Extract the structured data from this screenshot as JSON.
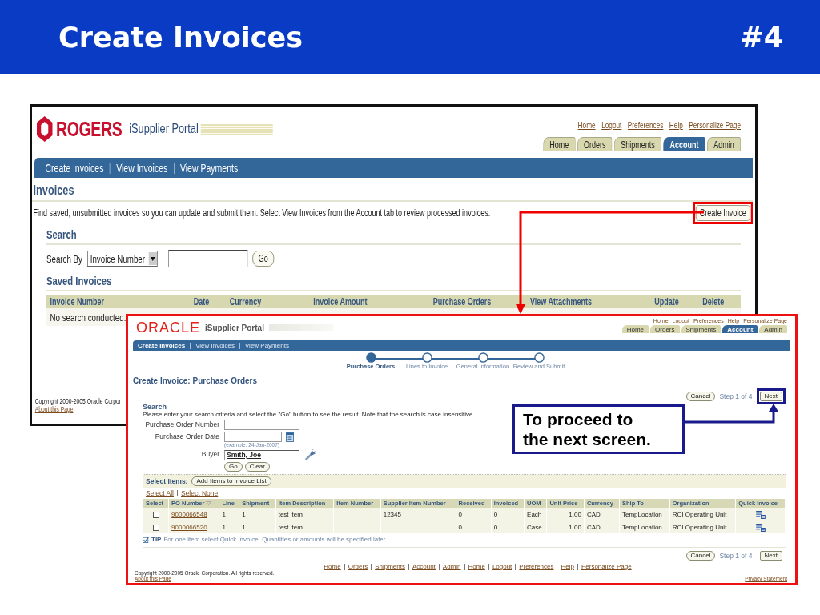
{
  "slide": {
    "title": "Create Invoices",
    "number": "#4"
  },
  "screen_1": {
    "logo_text": "ROGERS",
    "portal_name": "iSupplier Portal",
    "global_links": [
      "Home",
      "Logout",
      "Preferences",
      "Help",
      "Personalize Page"
    ],
    "tabs": [
      {
        "label": "Home",
        "selected": false
      },
      {
        "label": "Orders",
        "selected": false
      },
      {
        "label": "Shipments",
        "selected": false
      },
      {
        "label": "Account",
        "selected": true
      },
      {
        "label": "Admin",
        "selected": false
      }
    ],
    "subtabs": [
      "Create Invoices",
      "View Invoices",
      "View Payments"
    ],
    "page_title": "Invoices",
    "description": "Find saved, unsubmitted invoices so you can update and submit them. Select View Invoices from the Account tab to review processed invoices.",
    "create_button": {
      "label": "Create Invoice",
      "highlighted": true
    },
    "search": {
      "title": "Search",
      "label": "Search By",
      "select_value": "Invoice Number",
      "go_button": "Go"
    },
    "saved": {
      "title": "Saved Invoices",
      "columns": [
        "Invoice Number",
        "Date",
        "Currency",
        "Invoice Amount",
        "Purchase Orders",
        "View Attachments",
        "Update",
        "Delete"
      ],
      "empty_text": "No search conducted."
    },
    "copyright": "Copyright 2000-2005 Oracle Corpor",
    "about_link": "About this Page"
  },
  "screen_2": {
    "logo_text": "ORACLE",
    "portal_name": "iSupplier Portal",
    "global_links": [
      "Home",
      "Logout",
      "Preferences",
      "Help",
      "Personalize Page"
    ],
    "tabs": [
      {
        "label": "Home",
        "selected": false
      },
      {
        "label": "Orders",
        "selected": false
      },
      {
        "label": "Shipments",
        "selected": false
      },
      {
        "label": "Account",
        "selected": true
      },
      {
        "label": "Admin",
        "selected": false
      }
    ],
    "subtabs": [
      {
        "label": "Create Invoices",
        "selected": true
      },
      {
        "label": "View Invoices",
        "selected": false
      },
      {
        "label": "View Payments",
        "selected": false
      }
    ],
    "train": [
      {
        "label": "Purchase Orders",
        "selected": true
      },
      {
        "label": "Lines to Invoice",
        "selected": false
      },
      {
        "label": "General Information",
        "selected": false
      },
      {
        "label": "Review and Submit",
        "selected": false
      }
    ],
    "page_title": "Create Invoice: Purchase Orders",
    "top_actions": {
      "cancel": "Cancel",
      "step": "Step 1 of 4",
      "next": {
        "label": "Next",
        "highlighted": true
      }
    },
    "search": {
      "title": "Search",
      "instructions": "Please enter your search criteria and select the \"Go\" button to see the result. Note that the search is case insensitive.",
      "fields": [
        {
          "kind": "text",
          "label": "Purchase Order Number"
        },
        {
          "kind": "date",
          "label": "Purchase Order Date",
          "hint": "(example: 24-Jan-2007)"
        },
        {
          "kind": "lookup",
          "label": "Buyer",
          "value": "Smith, Joe"
        }
      ],
      "buttons": [
        "Go",
        "Clear"
      ]
    },
    "select_items": {
      "label": "Select Items:",
      "button": "Add Items to Invoice List"
    },
    "select_links": [
      "Select All",
      "Select None"
    ],
    "table": {
      "columns": [
        "Select",
        "PO Number",
        "Line",
        "Shipment",
        "Item Description",
        "Item Number",
        "Supplier Item Number",
        "Received",
        "Invoiced",
        "UOM",
        "Unit Price",
        "Currency",
        "Ship To",
        "Organization",
        "Quick Invoice"
      ],
      "rows": [
        {
          "checked": false,
          "po_number": "9000066548",
          "line": "1",
          "shipment": "1",
          "item_description": "test item",
          "supplier_item_number": "12345",
          "received": "0",
          "invoiced": "0",
          "uom": "Each",
          "unit_price": "1.00",
          "currency": "CAD",
          "ship_to": "TempLocation",
          "organization": "RCI Operating Unit"
        },
        {
          "checked": false,
          "po_number": "9000066520",
          "line": "1",
          "shipment": "1",
          "item_description": "test item",
          "received": "0",
          "invoiced": "0",
          "uom": "Case",
          "unit_price": "1.00",
          "currency": "CAD",
          "ship_to": "TempLocation",
          "organization": "RCI Operating Unit"
        }
      ]
    },
    "tip": {
      "label": "TIP",
      "text": "For one item select Quick Invoice. Quantities or amounts will be specified later."
    },
    "bottom_actions": {
      "cancel": "Cancel",
      "step": "Step 1 of 4",
      "next": {
        "label": "Next",
        "highlighted": false
      }
    },
    "footer_links": [
      "Home",
      "Orders",
      "Shipments",
      "Account",
      "Admin",
      "Home",
      "Logout",
      "Preferences",
      "Help",
      "Personalize Page"
    ],
    "copyright": "Copyright 2000-2005 Oracle Corporation. All rights reserved.",
    "about_link": "About this Page",
    "privacy_link": "Privacy Statement"
  },
  "callout": {
    "text": "To proceed to\nthe next screen."
  }
}
